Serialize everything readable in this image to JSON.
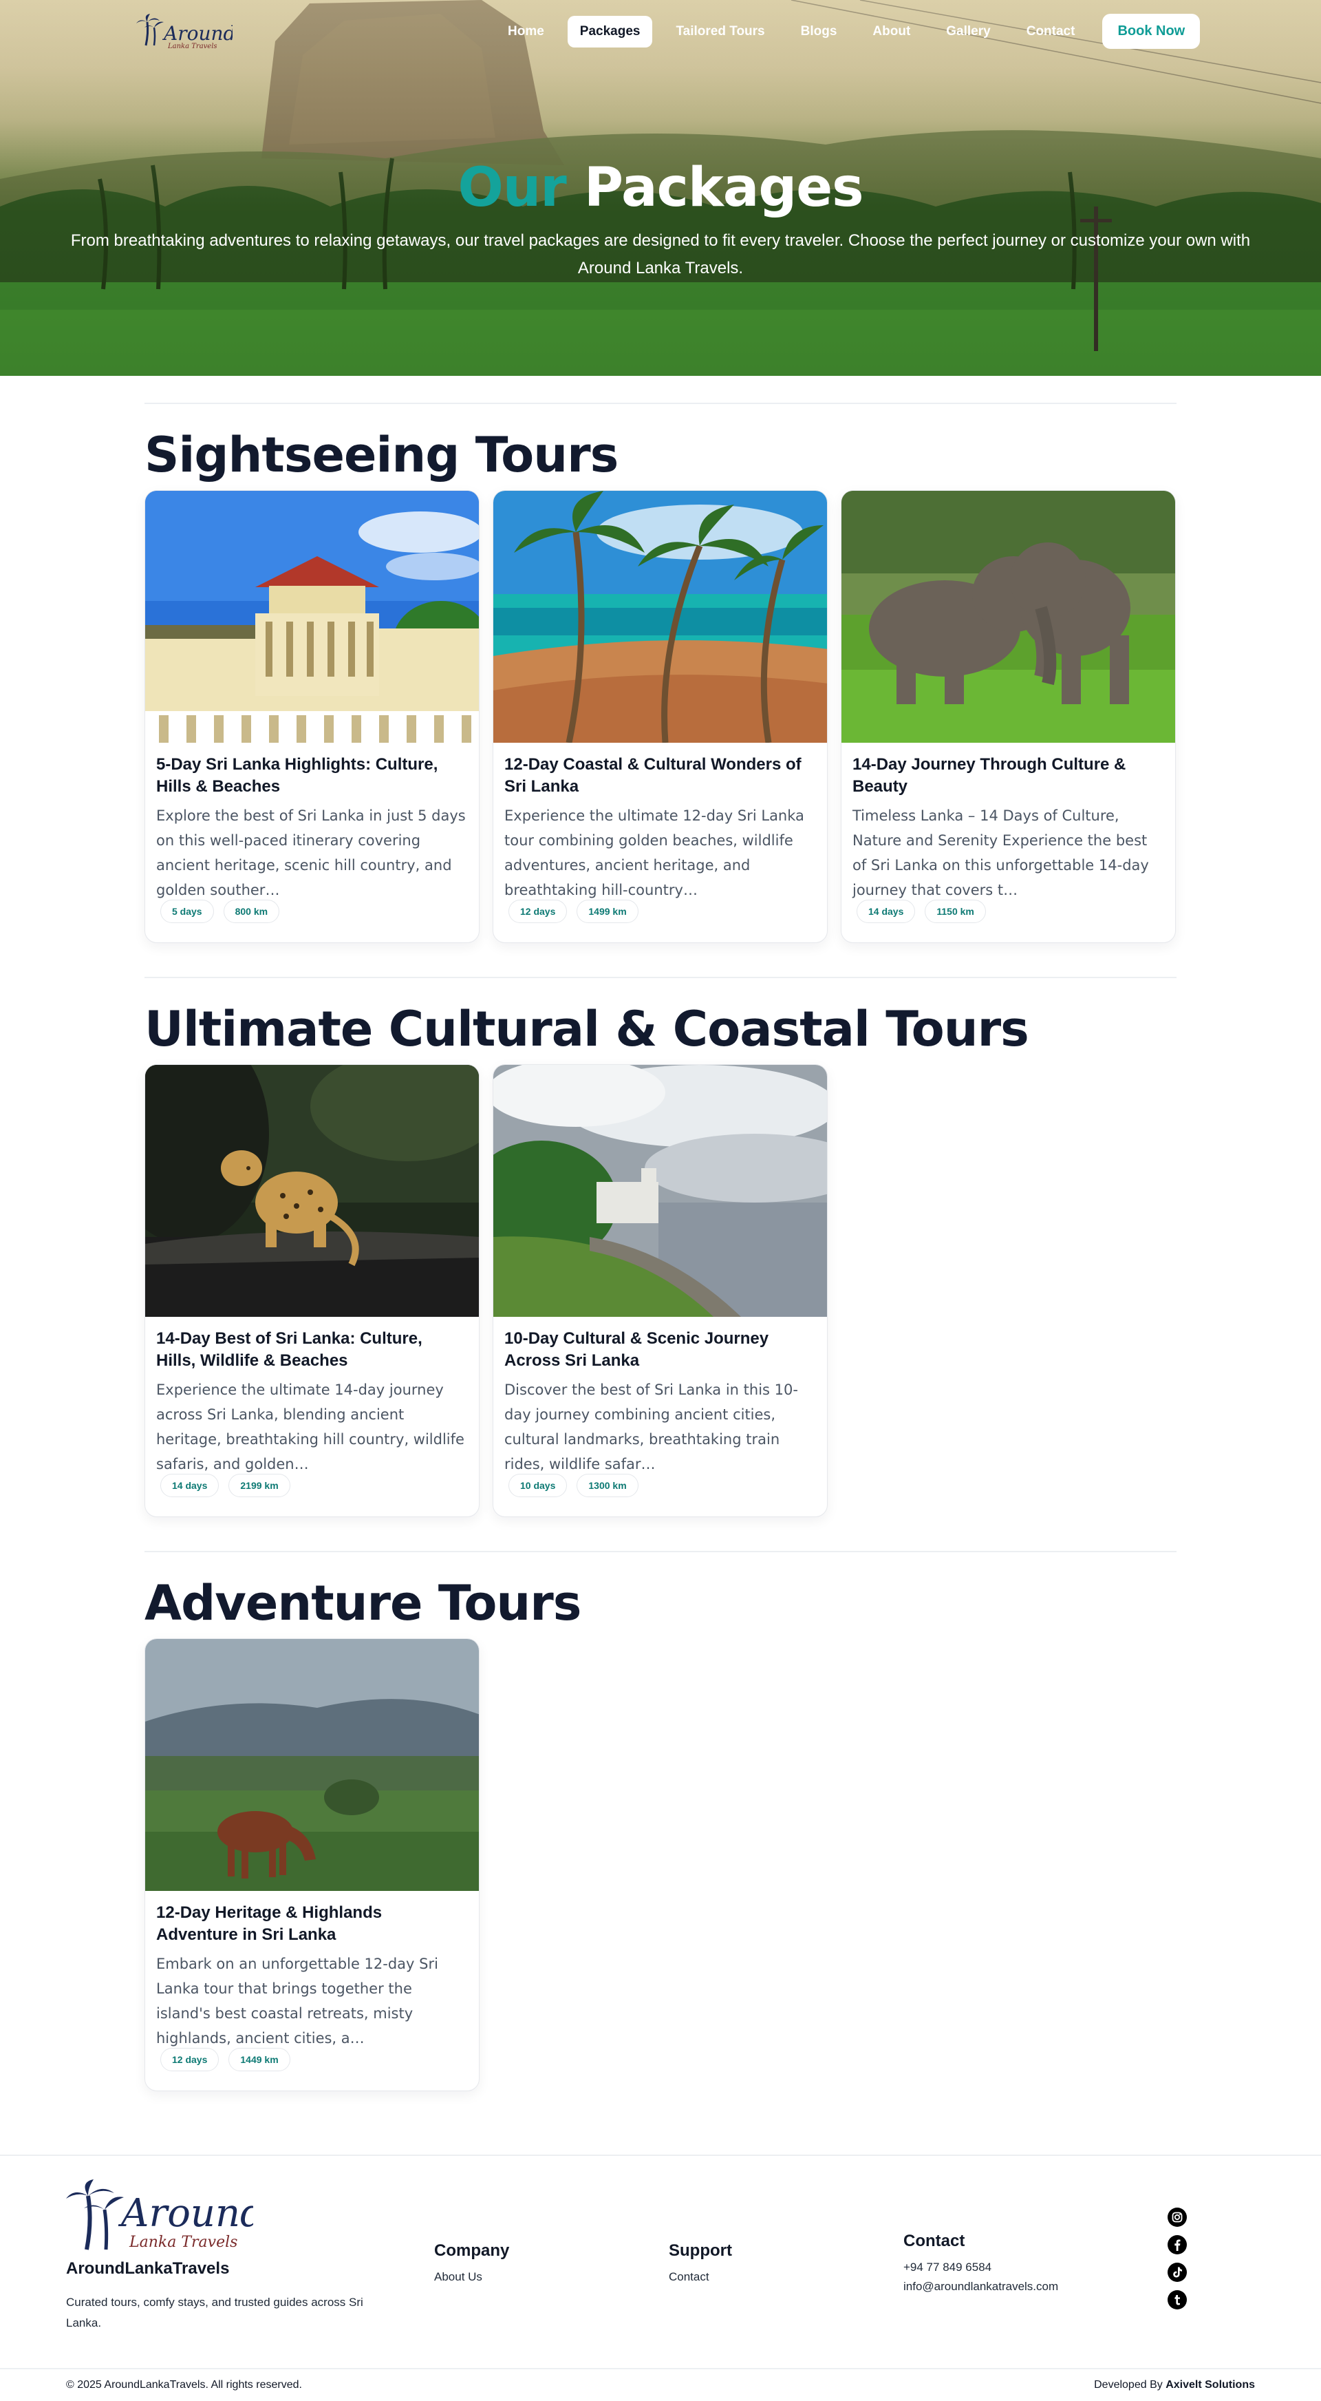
{
  "brand": {
    "logo_text": "Around",
    "logo_sub": "Lanka Travels",
    "name": "AroundLankaTravels",
    "tagline": "Curated tours, comfy stays, and trusted guides across Sri Lanka."
  },
  "nav": {
    "items": [
      "Home",
      "Packages",
      "Tailored Tours",
      "Blogs",
      "About",
      "Gallery",
      "Contact"
    ],
    "active": "Packages",
    "cta": "Book Now"
  },
  "hero": {
    "title_accent": "Our",
    "title_rest": "Packages",
    "subtitle": "From breathtaking adventures to relaxing getaways, our travel packages are designed to fit every traveler. Choose the perfect journey or customize your own with Around Lanka Travels."
  },
  "sections": [
    {
      "title": "Sightseeing Tours",
      "cards": [
        {
          "title": "5-Day Sri Lanka Highlights: Culture, Hills & Beaches",
          "desc": "Explore the best of Sri Lanka in just 5 days on this well-paced itinerary covering ancient heritage, scenic hill country, and golden souther…",
          "days": "5 days",
          "km": "800 km",
          "image": "temple"
        },
        {
          "title": "12-Day Coastal & Cultural Wonders of Sri Lanka",
          "desc": "Experience the ultimate 12-day Sri Lanka tour combining golden beaches, wildlife adventures, ancient heritage, and breathtaking hill-country…",
          "days": "12 days",
          "km": "1499 km",
          "image": "beach"
        },
        {
          "title": "14-Day Journey Through Culture & Beauty",
          "desc": "Timeless Lanka – 14 Days of Culture, Nature and Serenity Experience the best of Sri Lanka on this unforgettable 14-day journey that covers t…",
          "days": "14 days",
          "km": "1150 km",
          "image": "elephants"
        }
      ]
    },
    {
      "title": "Ultimate Cultural & Coastal Tours",
      "cards": [
        {
          "title": "14-Day Best of Sri Lanka: Culture, Hills, Wildlife & Beaches",
          "desc": "Experience the ultimate 14-day journey across Sri Lanka, blending ancient heritage, breathtaking hill country, wildlife safaris, and golden…",
          "days": "14 days",
          "km": "2199 km",
          "image": "leopard"
        },
        {
          "title": "10-Day Cultural & Scenic Journey Across Sri Lanka",
          "desc": "Discover the best of Sri Lanka in this 10-day journey combining ancient cities, cultural landmarks, breathtaking train rides, wildlife safar…",
          "days": "10 days",
          "km": "1300 km",
          "image": "fort"
        }
      ]
    },
    {
      "title": "Adventure Tours",
      "cards": [
        {
          "title": "12-Day Heritage & Highlands Adventure in Sri Lanka",
          "desc": "Embark on an unforgettable 12-day Sri Lanka tour that brings together the island's best coastal retreats, misty highlands, ancient cities, a…",
          "days": "12 days",
          "km": "1449 km",
          "image": "horse"
        }
      ]
    }
  ],
  "footer": {
    "company_heading": "Company",
    "company_links": [
      "About Us"
    ],
    "support_heading": "Support",
    "support_links": [
      "Contact"
    ],
    "contact_heading": "Contact",
    "phone": "+94 77 849 6584",
    "email": "info@aroundlankatravels.com",
    "social_icons": [
      "instagram-icon",
      "facebook-icon",
      "tiktok-icon",
      "tumblr-icon"
    ],
    "copyright": "© 2025 AroundLankaTravels. All rights reserved.",
    "developed_by_label": "Developed By",
    "developer": "Axivelt Solutions"
  },
  "colors": {
    "accent": "#14a39b",
    "heading": "#121a2e",
    "chip_text": "#0e7a74"
  }
}
